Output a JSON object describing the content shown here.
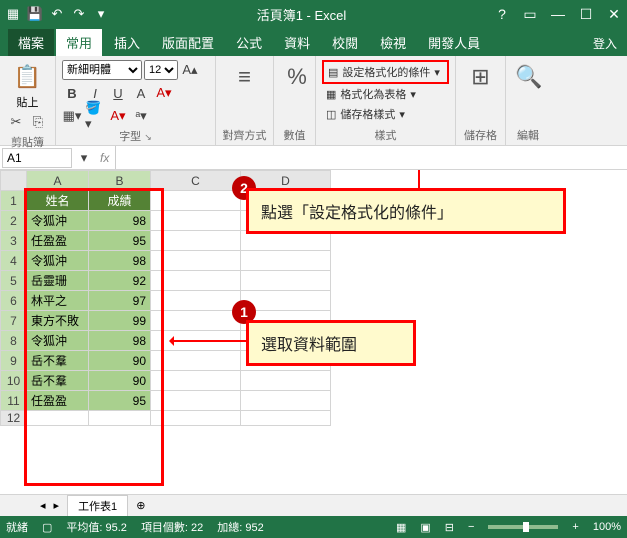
{
  "title": "活頁簿1 - Excel",
  "login": "登入",
  "tabs": {
    "file": "檔案",
    "home": "常用",
    "insert": "插入",
    "layout": "版面配置",
    "formulas": "公式",
    "data": "資料",
    "review": "校閱",
    "view": "檢視",
    "dev": "開發人員"
  },
  "ribbon": {
    "clipboard": {
      "label": "剪貼簿",
      "paste": "貼上"
    },
    "font": {
      "label": "字型",
      "name": "新細明體",
      "size": "12"
    },
    "alignment": {
      "label": "對齊方式"
    },
    "number": {
      "label": "數值",
      "pct": "%"
    },
    "styles": {
      "label": "樣式",
      "cond": "設定格式化的條件",
      "table": "格式化為表格",
      "cell": "儲存格樣式"
    },
    "cells": {
      "label": "儲存格"
    },
    "editing": {
      "label": "編輯"
    }
  },
  "namebox": "A1",
  "callouts": {
    "c1": {
      "num": "1",
      "text": "選取資料範圍"
    },
    "c2": {
      "num": "2",
      "text": "點選「設定格式化的條件」"
    }
  },
  "cols": [
    "A",
    "B",
    "C",
    "D"
  ],
  "header_row": {
    "a": "姓名",
    "b": "成績"
  },
  "rows": [
    {
      "n": "1"
    },
    {
      "n": "2",
      "a": "令狐沖",
      "b": "98"
    },
    {
      "n": "3",
      "a": "任盈盈",
      "b": "95"
    },
    {
      "n": "4",
      "a": "令狐沖",
      "b": "98"
    },
    {
      "n": "5",
      "a": "岳靈珊",
      "b": "92"
    },
    {
      "n": "6",
      "a": "林平之",
      "b": "97"
    },
    {
      "n": "7",
      "a": "東方不敗",
      "b": "99"
    },
    {
      "n": "8",
      "a": "令狐沖",
      "b": "98"
    },
    {
      "n": "9",
      "a": "岳不羣",
      "b": "90"
    },
    {
      "n": "10",
      "a": "岳不羣",
      "b": "90"
    },
    {
      "n": "11",
      "a": "任盈盈",
      "b": "95"
    },
    {
      "n": "12"
    }
  ],
  "sheet_tab": "工作表1",
  "status": {
    "ready": "就緒",
    "avg": "平均值: 95.2",
    "count": "項目個數: 22",
    "sum": "加總: 952",
    "zoom": "100%"
  },
  "chart_data": {
    "type": "table",
    "columns": [
      "姓名",
      "成績"
    ],
    "rows": [
      [
        "令狐沖",
        98
      ],
      [
        "任盈盈",
        95
      ],
      [
        "令狐沖",
        98
      ],
      [
        "岳靈珊",
        92
      ],
      [
        "林平之",
        97
      ],
      [
        "東方不敗",
        99
      ],
      [
        "令狐沖",
        98
      ],
      [
        "岳不羣",
        90
      ],
      [
        "岳不羣",
        90
      ],
      [
        "任盈盈",
        95
      ]
    ],
    "title": "成績"
  }
}
